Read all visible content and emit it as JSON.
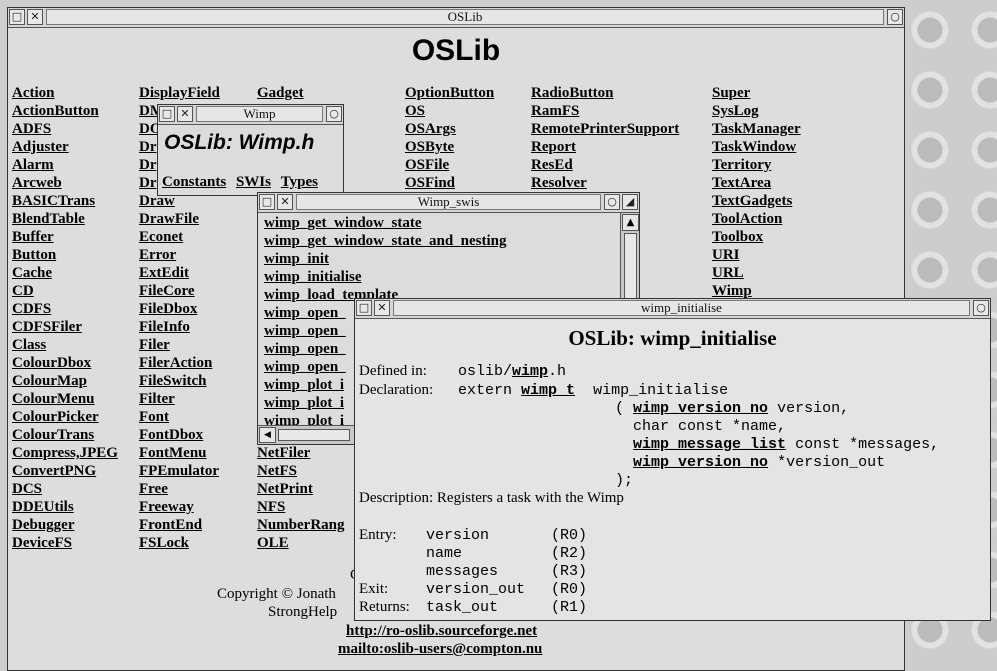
{
  "main": {
    "title": "OSLib",
    "heading": "OSLib",
    "col1": [
      "Action",
      "ActionButton",
      "ADFS",
      "Adjuster",
      "Alarm",
      "Arcweb",
      "BASICTrans",
      "BlendTable",
      "Buffer",
      "Button",
      "Cache",
      "CD",
      "CDFS",
      "CDFSFiler",
      "Class",
      "ColourDbox",
      "ColourMap",
      "ColourMenu",
      "ColourPicker",
      "ColourTrans",
      "Compress,JPEG",
      "ConvertPNG",
      "DCS",
      "DDEUtils",
      "Debugger",
      "DeviceFS"
    ],
    "col2": [
      "DisplayField",
      "DM",
      "DO",
      "Dr",
      "Dr",
      "Dr",
      "Draw",
      "DrawFile",
      "Econet",
      "Error",
      "ExtEdit",
      "FileCore",
      "FileDbox",
      "FileInfo",
      "Filer",
      "FilerAction",
      "FileSwitch",
      "Filter",
      "Font",
      "FontDbox",
      "FontMenu",
      "FPEmulator",
      "Free",
      "Freeway",
      "FrontEnd",
      "FSLock"
    ],
    "col3_top": "Gadget",
    "col3_bottom": [
      "NetFiler",
      "NetFS",
      "NetPrint",
      "NFS",
      "NumberRang",
      "OLE"
    ],
    "col4": [
      "OptionButton",
      "OS",
      "OSArgs",
      "OSByte",
      "OSFile",
      "OSFind"
    ],
    "col5": [
      "RadioButton",
      "RamFS",
      "RemotePrinterSupport",
      "Report",
      "ResEd",
      "Resolver"
    ],
    "col6": [
      "Super",
      "SysLog",
      "TaskManager",
      "TaskWindow",
      "Territory",
      "TextArea",
      "TextGadgets",
      "ToolAction",
      "Toolbox",
      "URI",
      "URL",
      "Wimp"
    ],
    "footer_c": "C",
    "footer_copyright": "Copyright © Jonath",
    "footer_stronghelp": "StrongHelp",
    "footer_link1": "http://ro-oslib.sourceforge.net",
    "footer_link2": "mailto:oslib-users@compton.nu"
  },
  "wimp_win": {
    "title": "Wimp",
    "heading": "OSLib: Wimp.h",
    "links": [
      "Constants",
      "SWIs",
      "Types"
    ]
  },
  "swis_win": {
    "title": "Wimp_swis",
    "items": [
      "wimp_get_window_state",
      "wimp_get_window_state_and_nesting",
      "wimp_init",
      "wimp_initialise",
      "wimp_load_template",
      "wimp_open_",
      "wimp_open_",
      "wimp_open_",
      "wimp_open_",
      "wimp_plot_i",
      "wimp_plot_i",
      "wimp_plot_i"
    ]
  },
  "init_win": {
    "title": "wimp_initialise",
    "heading": "OSLib: wimp_initialise",
    "defined_label": "Defined in:",
    "defined_pre": "oslib/",
    "defined_link": "wimp",
    "defined_post": ".h",
    "decl_label": "Declaration:",
    "decl_extern": "extern",
    "decl_type": "wimp_t",
    "decl_name": "wimp_initialise",
    "arg1_open": "(",
    "arg1_type": "wimp_version_no",
    "arg1_rest": "version,",
    "arg2": "char const *name,",
    "arg3_type": "wimp_message_list",
    "arg3_rest": "const *messages,",
    "arg4_type": "wimp_version_no",
    "arg4_rest": "*version_out",
    "close": ");",
    "desc_label": "Description:",
    "desc_text": "Registers a task with the Wimp",
    "entry_label": "Entry:",
    "entry": [
      {
        "name": "version",
        "reg": "(R0)"
      },
      {
        "name": "name",
        "reg": "(R2)"
      },
      {
        "name": "messages",
        "reg": "(R3)"
      }
    ],
    "exit_label": "Exit:",
    "exit": {
      "name": "version_out",
      "reg": "(R0)"
    },
    "returns_label": "Returns:",
    "returns": {
      "name": "task_out",
      "reg": "(R1)"
    }
  },
  "icons": {
    "back": "back-icon",
    "close": "close-icon",
    "toggle": "toggle-size-icon"
  }
}
